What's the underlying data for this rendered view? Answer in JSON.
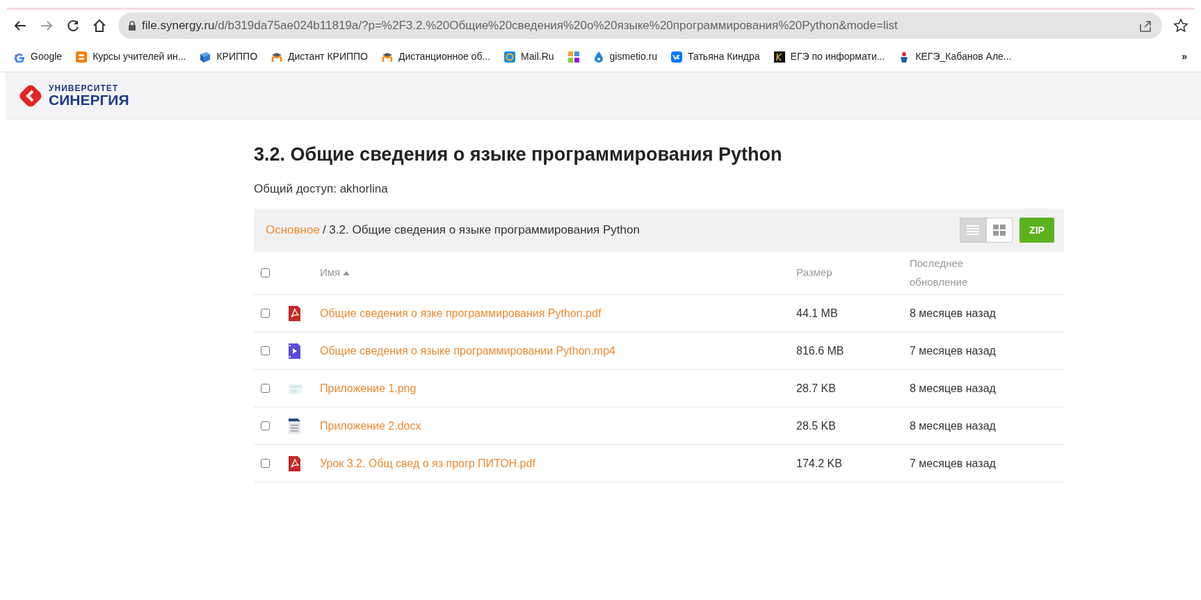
{
  "browser": {
    "url_host": "file.synergy.ru",
    "url_rest": "/d/b319da75ae024b11819a/?p=%2F3.2.%20Общие%20сведения%20о%20языке%20программирования%20Python&mode=list",
    "bookmarks": [
      {
        "kind": "google",
        "label": "Google"
      },
      {
        "kind": "blogger",
        "label": "Курсы учителей ин..."
      },
      {
        "kind": "book",
        "label": "КРИППО"
      },
      {
        "kind": "moodle",
        "label": "Дистант КРИППО"
      },
      {
        "kind": "moodle",
        "label": "Дистанционное об..."
      },
      {
        "kind": "mail",
        "label": "Mail.Ru"
      },
      {
        "kind": "tiles"
      },
      {
        "kind": "drop",
        "label": "gismetio.ru"
      },
      {
        "kind": "vk",
        "label": "Татьяна Киндра"
      },
      {
        "kind": "dark",
        "label": "ЕГЭ по информати..."
      },
      {
        "kind": "figure",
        "label": "КЕГЭ_Кабанов Але..."
      }
    ],
    "more": "»"
  },
  "logo": {
    "line1": "УНИВЕРСИТЕТ",
    "line2": "СИНЕРГИЯ"
  },
  "page": {
    "title": "3.2. Общие сведения о языке программирования Python",
    "share": "Общий доступ: akhorlina"
  },
  "breadcrumb": [
    {
      "label": "Основное",
      "link": true
    },
    {
      "label": "/ 3.2. Общие сведения о языке программирования Python",
      "link": false
    }
  ],
  "view_buttons": [
    {
      "kind": "list",
      "selected": true
    },
    {
      "kind": "grid",
      "selected": false
    }
  ],
  "zip_button": "ZIP",
  "table": {
    "select_all": {
      "checked": false
    },
    "columns": [
      "Имя",
      "Размер",
      "Последнее обновление"
    ],
    "sort_ascending": true,
    "rows": [
      {
        "checked": false,
        "kind": "pdf",
        "name": "Общие сведения о язке программирования Python.pdf",
        "size": "44.1 MB",
        "updated": "8 месяцев назад"
      },
      {
        "checked": false,
        "kind": "video",
        "name": "Общие сведения о языке программировании Python.mp4",
        "size": "816.6 MB",
        "updated": "7 месяцев назад"
      },
      {
        "checked": false,
        "kind": "image",
        "name": "Приложение 1.png",
        "size": "28.7 KB",
        "updated": "8 месяцев назад"
      },
      {
        "checked": false,
        "kind": "doc",
        "name": "Приложение 2.docx",
        "size": "28.5 KB",
        "updated": "8 месяцев назад"
      },
      {
        "checked": false,
        "kind": "pdf",
        "name": "Урок 3.2. Общ свед о яз прогр ПИТОН.pdf",
        "size": "174.2 KB",
        "updated": "7 месяцев назад"
      }
    ]
  }
}
